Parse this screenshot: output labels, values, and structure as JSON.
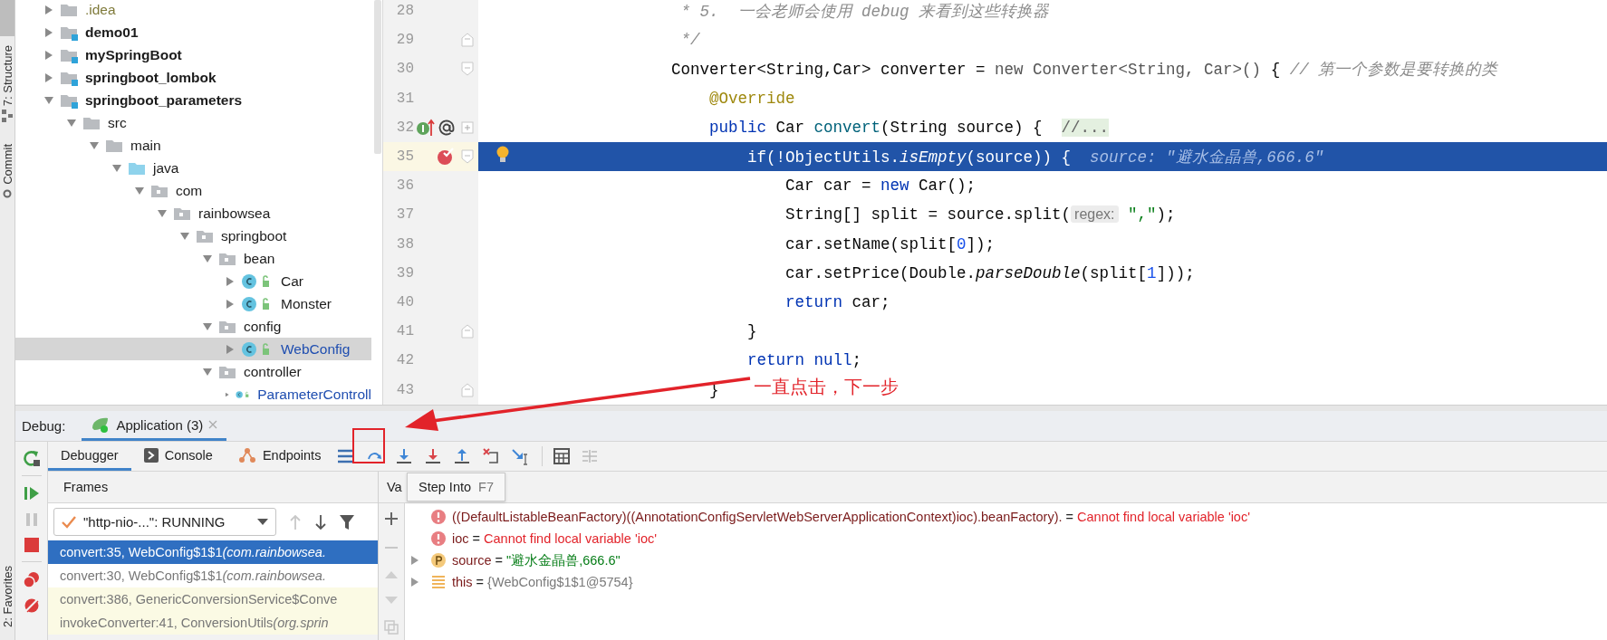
{
  "tool_windows": [
    {
      "label": "7: Structure"
    },
    {
      "label": "Commit"
    },
    {
      "label": "2: Favorites"
    }
  ],
  "project_tree": [
    {
      "label": ".idea",
      "kind": "folder",
      "color": "#7f7a3a",
      "expanded": false,
      "selected": false
    },
    {
      "label": "demo01",
      "kind": "module",
      "color": "#1c1c1c",
      "expanded": false,
      "selected": false
    },
    {
      "label": "mySpringBoot",
      "kind": "module",
      "color": "#1c1c1c",
      "expanded": false,
      "selected": false
    },
    {
      "label": "springboot_lombok",
      "kind": "module",
      "color": "#1c1c1c",
      "expanded": false,
      "selected": false
    },
    {
      "label": "springboot_parameters",
      "kind": "module",
      "color": "#1c1c1c",
      "expanded": true,
      "selected": false,
      "children": [
        {
          "label": "src",
          "kind": "folder",
          "color": "#1c1c1c",
          "expanded": true,
          "selected": false,
          "children": [
            {
              "label": "main",
              "kind": "folder",
              "color": "#1c1c1c",
              "expanded": true,
              "selected": false,
              "children": [
                {
                  "label": "java",
                  "kind": "source",
                  "color": "#1c1c1c",
                  "expanded": true,
                  "selected": false,
                  "children": [
                    {
                      "label": "com",
                      "kind": "package",
                      "color": "#1c1c1c",
                      "expanded": true,
                      "selected": false,
                      "children": [
                        {
                          "label": "rainbowsea",
                          "kind": "package",
                          "color": "#1c1c1c",
                          "expanded": true,
                          "selected": false,
                          "children": [
                            {
                              "label": "springboot",
                              "kind": "package",
                              "color": "#1c1c1c",
                              "expanded": true,
                              "selected": false,
                              "children": [
                                {
                                  "label": "bean",
                                  "kind": "package",
                                  "color": "#1c1c1c",
                                  "expanded": true,
                                  "selected": false,
                                  "children": [
                                    {
                                      "label": "Car",
                                      "kind": "class",
                                      "color": "#1c1c1c",
                                      "expanded": false,
                                      "selected": false
                                    },
                                    {
                                      "label": "Monster",
                                      "kind": "class",
                                      "color": "#1c1c1c",
                                      "expanded": false,
                                      "selected": false
                                    }
                                  ]
                                },
                                {
                                  "label": "config",
                                  "kind": "package",
                                  "color": "#1c1c1c",
                                  "expanded": true,
                                  "selected": false,
                                  "children": [
                                    {
                                      "label": "WebConfig",
                                      "kind": "class",
                                      "color": "#1f4eb0",
                                      "expanded": false,
                                      "selected": true
                                    }
                                  ]
                                },
                                {
                                  "label": "controller",
                                  "kind": "package",
                                  "color": "#1c1c1c",
                                  "expanded": true,
                                  "selected": false,
                                  "children": [
                                    {
                                      "label": "ParameterControll",
                                      "kind": "class",
                                      "color": "#1f4eb0",
                                      "expanded": false,
                                      "selected": false
                                    }
                                  ]
                                }
                              ]
                            }
                          ]
                        }
                      ]
                    }
                  ]
                }
              ]
            }
          ]
        }
      ]
    }
  ],
  "editor": {
    "lines": [
      {
        "number": "28",
        "current": false,
        "breakpoint": false,
        "overrides": false,
        "tokens": [
          {
            "kind": "comment",
            "text": "     * 5.  一会老师会使用 debug 来看到这些转换器"
          }
        ]
      },
      {
        "number": "29",
        "current": false,
        "breakpoint": false,
        "overrides": false,
        "fold": {
          "kind": "end"
        },
        "tokens": [
          {
            "kind": "comment",
            "text": "     */"
          }
        ]
      },
      {
        "number": "30",
        "current": false,
        "breakpoint": false,
        "overrides": false,
        "fold": {
          "kind": "start"
        },
        "tokens": [
          {
            "kind": "plain",
            "text": "    Converter<String,Car> converter = "
          },
          {
            "kind": "muted",
            "text": "new Converter<String, Car>()"
          },
          {
            "kind": "plain",
            "text": " { "
          },
          {
            "kind": "comment",
            "text": "// 第一个参数是要转换的类"
          }
        ]
      },
      {
        "number": "31",
        "current": false,
        "breakpoint": false,
        "overrides": false,
        "tokens": [
          {
            "kind": "annotation",
            "text": "        @Override"
          }
        ]
      },
      {
        "number": "32",
        "current": false,
        "breakpoint": false,
        "overrides": true,
        "fold": {
          "kind": "collapsed"
        },
        "tokens": [
          {
            "kind": "keyword",
            "text": "        public"
          },
          {
            "kind": "plain",
            "text": " Car "
          },
          {
            "kind": "method",
            "text": "convert"
          },
          {
            "kind": "plain",
            "text": "(String source) {  "
          },
          {
            "kind": "folded",
            "text": "//..."
          }
        ]
      },
      {
        "number": "35",
        "current": true,
        "breakpoint": true,
        "overrides": false,
        "fold": {
          "kind": "start"
        },
        "tokens": [
          {
            "kind": "plain",
            "text": "            if(!ObjectUtils."
          },
          {
            "kind": "italic",
            "text": "isEmpty"
          },
          {
            "kind": "plain",
            "text": "(source)) {  "
          },
          {
            "kind": "debug_value",
            "text": "source: \"避水金晶兽,666.6\""
          }
        ]
      },
      {
        "number": "36",
        "current": false,
        "breakpoint": false,
        "overrides": false,
        "tokens": [
          {
            "kind": "plain",
            "text": "                Car car = "
          },
          {
            "kind": "keyword",
            "text": "new"
          },
          {
            "kind": "plain",
            "text": " Car();"
          }
        ]
      },
      {
        "number": "37",
        "current": false,
        "breakpoint": false,
        "overrides": false,
        "tokens": [
          {
            "kind": "plain",
            "text": "                String[] split = source.split("
          },
          {
            "kind": "param_hint",
            "text": "regex:"
          },
          {
            "kind": "string",
            "text": " \",\""
          },
          {
            "kind": "plain",
            "text": ");"
          }
        ]
      },
      {
        "number": "38",
        "current": false,
        "breakpoint": false,
        "overrides": false,
        "tokens": [
          {
            "kind": "plain",
            "text": "                car.setName(split["
          },
          {
            "kind": "number",
            "text": "0"
          },
          {
            "kind": "plain",
            "text": "]);"
          }
        ]
      },
      {
        "number": "39",
        "current": false,
        "breakpoint": false,
        "overrides": false,
        "tokens": [
          {
            "kind": "plain",
            "text": "                car.setPrice(Double."
          },
          {
            "kind": "italic",
            "text": "parseDouble"
          },
          {
            "kind": "plain",
            "text": "(split["
          },
          {
            "kind": "number",
            "text": "1"
          },
          {
            "kind": "plain",
            "text": "]));"
          }
        ]
      },
      {
        "number": "40",
        "current": false,
        "breakpoint": false,
        "overrides": false,
        "tokens": [
          {
            "kind": "keyword",
            "text": "                return"
          },
          {
            "kind": "plain",
            "text": " car;"
          }
        ]
      },
      {
        "number": "41",
        "current": false,
        "breakpoint": false,
        "overrides": false,
        "fold": {
          "kind": "end"
        },
        "tokens": [
          {
            "kind": "plain",
            "text": "            }"
          }
        ]
      },
      {
        "number": "42",
        "current": false,
        "breakpoint": false,
        "overrides": false,
        "tokens": [
          {
            "kind": "keyword",
            "text": "            return null"
          },
          {
            "kind": "plain",
            "text": ";"
          }
        ]
      },
      {
        "number": "43",
        "current": false,
        "breakpoint": false,
        "overrides": false,
        "fold": {
          "kind": "end"
        },
        "tokens": [
          {
            "kind": "plain",
            "text": "        }"
          }
        ]
      }
    ]
  },
  "annotation": {
    "text": "一直点击，下一步"
  },
  "debug": {
    "title": "Debug:",
    "session_tab": {
      "label": "Application (3)",
      "selected": true
    },
    "tabs": [
      {
        "label": "Debugger",
        "selected": true
      },
      {
        "label": "Console",
        "selected": false
      },
      {
        "label": "Endpoints",
        "selected": false
      }
    ],
    "tooltip": {
      "label": "Step Into",
      "shortcut": "F7"
    },
    "frames": {
      "header": "Frames",
      "thread": "\"http-nio-...\": RUNNING",
      "rows": [
        {
          "method": "convert:35, WebConfig$1$1 ",
          "location": "(com.rainbowsea.",
          "selected": true,
          "library": false
        },
        {
          "method": "convert:30, WebConfig$1$1 ",
          "location": "(com.rainbowsea.",
          "selected": false,
          "library": false
        },
        {
          "method": "convert:386, GenericConversionService$Conve",
          "selected": false,
          "library": true
        },
        {
          "method": "invokeConverter:41, ConversionUtils ",
          "location": "(org.sprin",
          "selected": false,
          "library": true
        }
      ]
    },
    "variables": {
      "header": "Va",
      "rows": [
        {
          "kind": "error",
          "name": "((DefaultListableBeanFactory)((AnnotationConfigServletWebServerApplicationContext)ioc).beanFactory).",
          "sign": "=",
          "value": "Cannot find local variable 'ioc'",
          "expandable": false
        },
        {
          "kind": "error",
          "name": "ioc",
          "sign": "=",
          "value": "Cannot find local variable 'ioc'",
          "expandable": false
        },
        {
          "kind": "param",
          "name": "source",
          "sign": "=",
          "value": "\"避水金晶兽,666.6\"",
          "expandable": true
        },
        {
          "kind": "object",
          "name": "this",
          "sign": "=",
          "value": "{WebConfig$1$1@5754}",
          "expandable": true
        }
      ]
    }
  }
}
